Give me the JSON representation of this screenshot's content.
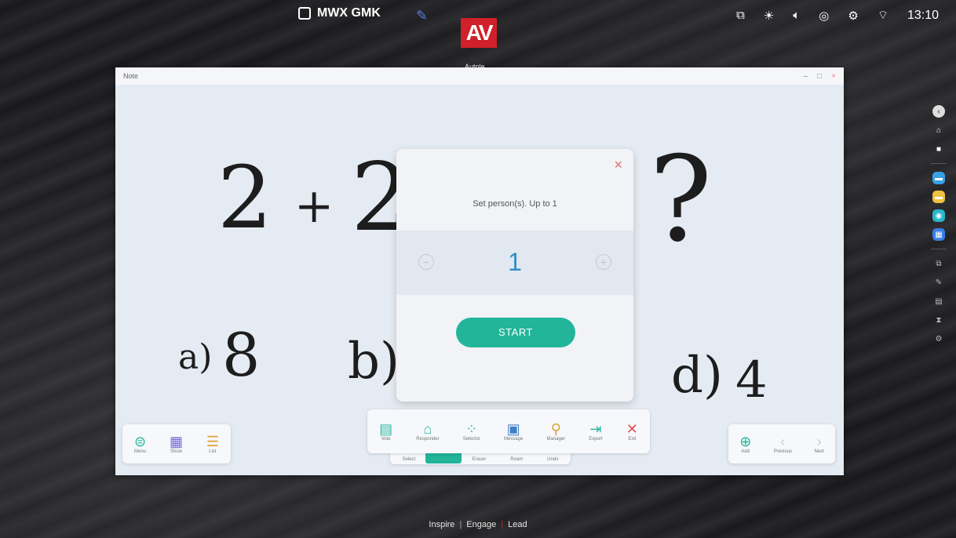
{
  "top_bar": {
    "device_name": "MWX GMK",
    "logo_text": "AV",
    "logo_sub": "Autole",
    "clock": "13:10"
  },
  "window": {
    "title": "Note",
    "controls": {
      "minimize": "–",
      "maximize": "□",
      "close": "×"
    }
  },
  "handwriting": {
    "h1": "2",
    "h2": "+",
    "h3": "2",
    "h4": "?",
    "a_label": "a)",
    "a_val": "8",
    "b_label": "b)",
    "d_label": "d)",
    "d_val": "4"
  },
  "dialog": {
    "close": "×",
    "prompt": "Set person(s). Up to 1",
    "minus": "−",
    "plus": "+",
    "value": "1",
    "start": "START"
  },
  "left_tools": [
    {
      "icon": "menu-icon",
      "glyph": "⊜",
      "label": "Menu",
      "color": "#22b59a"
    },
    {
      "icon": "grid-icon",
      "glyph": "▦",
      "label": "Show",
      "color": "#7a6bd8"
    },
    {
      "icon": "list-icon",
      "glyph": "☰",
      "label": "List",
      "color": "#e0a13a"
    }
  ],
  "center_tools": [
    {
      "icon": "vote-icon",
      "glyph": "▤",
      "label": "Vote",
      "color": "#2eb8a0"
    },
    {
      "icon": "responder-icon",
      "glyph": "⌂",
      "label": "Responder",
      "color": "#2eb8a0"
    },
    {
      "icon": "selector-icon",
      "glyph": "⁘",
      "label": "Selector",
      "color": "#2eb8a0"
    },
    {
      "icon": "message-icon",
      "glyph": "▣",
      "label": "Message",
      "color": "#3f7fc6"
    },
    {
      "icon": "manager-icon",
      "glyph": "⚲",
      "label": "Manager",
      "color": "#e0a13a"
    },
    {
      "icon": "export-icon",
      "glyph": "⇥",
      "label": "Export",
      "color": "#2eb8a0"
    },
    {
      "icon": "exit-icon",
      "glyph": "✕",
      "label": "Exit",
      "color": "#e05050"
    }
  ],
  "under_tools": [
    "Select",
    "Pen",
    "Eraser",
    "Roam",
    "Undo"
  ],
  "right_tools": [
    {
      "icon": "add-icon",
      "glyph": "⊕",
      "label": "Add",
      "color": "#22b59a"
    },
    {
      "icon": "previous-icon",
      "glyph": "‹",
      "label": "Previous",
      "color": "#c9ced6"
    },
    {
      "icon": "next-icon",
      "glyph": "›",
      "label": "Next",
      "color": "#c9ced6"
    }
  ],
  "footer": {
    "inspire": "Inspire",
    "engage": "Engage",
    "lead": "Lead"
  }
}
